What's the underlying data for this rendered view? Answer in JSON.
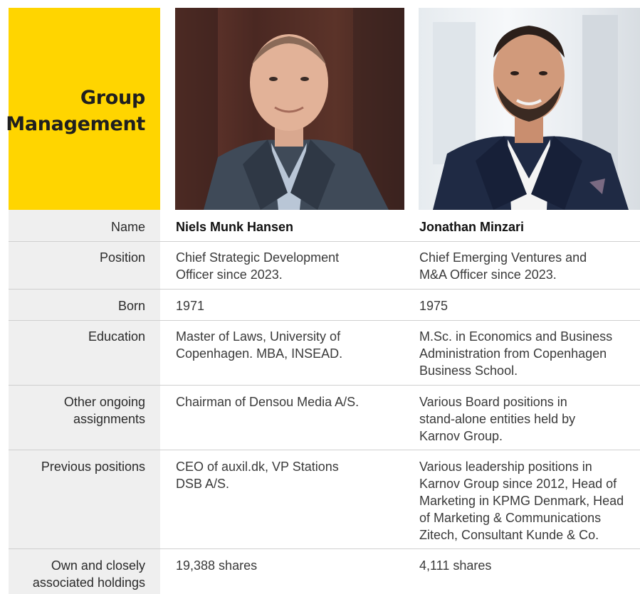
{
  "header": {
    "title": "Group\nManagement"
  },
  "people": [
    {
      "name": "Niels Munk Hansen",
      "photo": "portrait-photo-niels"
    },
    {
      "name": "Jonathan Minzari",
      "photo": "portrait-photo-jonathan"
    }
  ],
  "rows": {
    "name": {
      "label": "Name",
      "c1": "Niels Munk Hansen",
      "c2": "Jonathan Minzari"
    },
    "position": {
      "label": "Position",
      "c1": "Chief Strategic Development\nOfficer since 2023.",
      "c2": "Chief Emerging Ventures and\nM&A Officer since 2023."
    },
    "born": {
      "label": "Born",
      "c1": "1971",
      "c2": "1975"
    },
    "education": {
      "label": "Education",
      "c1": "Master of Laws, University of\nCopenhagen. MBA, INSEAD.",
      "c2": "M.Sc. in Economics and Business\nAdministration from Copenhagen\nBusiness School."
    },
    "assignments": {
      "label": "Other ongoing\nassignments",
      "c1": "Chairman of Densou Media A/S.",
      "c2": "Various Board positions in\nstand-alone entities held by\nKarnov Group."
    },
    "previous": {
      "label": "Previous positions",
      "c1": "CEO of auxil.dk, VP Stations\nDSB A/S.",
      "c2": "Various leadership positions in\nKarnov Group since 2012, Head of\nMarketing in KPMG Denmark, Head\nof Marketing & Communications\nZitech, Consultant Kunde & Co."
    },
    "holdings": {
      "label": "Own and closely\nassociated holdings",
      "c1": "19,388 shares",
      "c2": "4,111 shares"
    }
  },
  "colors": {
    "accent": "#ffd500",
    "label_bg": "#efefef",
    "rule": "#cfcfcf"
  }
}
